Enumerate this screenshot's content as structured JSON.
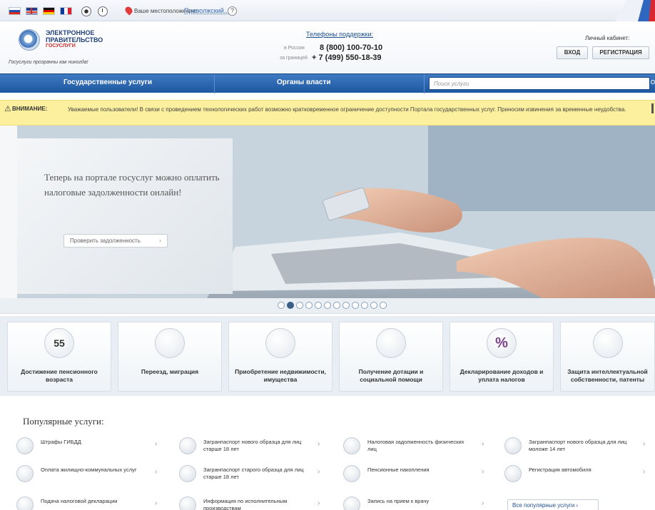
{
  "topbar": {
    "location_label": "Ваше местоположение:",
    "location_value": "Приволжский...",
    "help": "?"
  },
  "header": {
    "logo_line1": "ЭЛЕКТРОННОЕ",
    "logo_line2": "ПРАВИТЕЛЬСТВО",
    "logo_line3": "ГОСУСЛУГИ",
    "slogan": "Госуслуги прозрачны как никогда!",
    "support_title": "Телефоны поддержки:",
    "support_label_russia": "в России",
    "support_phone_russia": "8 (800) 100-70-10",
    "support_label_abroad": "за границей",
    "support_phone_abroad": "+ 7 (499) 550-18-39",
    "cabinet_title": "Личный кабинет:",
    "login": "ВХОД",
    "register": "РЕГИСТРАЦИЯ"
  },
  "nav": {
    "services": "Государственные услуги",
    "authorities": "Органы власти",
    "search_placeholder": "Поиск услуги"
  },
  "alert": {
    "icon": "⚠",
    "title": "ВНИМАНИЕ:",
    "text": "Уважаемые пользователи! В связи с проведением технологических работ возможно кратковременное ограничение доступности Портала государственных услуг. Приносим извинения за временные неудобства."
  },
  "banner": {
    "text": "Теперь на портале госуслуг можно оплатить налоговые задолженности онлайн!",
    "button": "Проверить задолженность",
    "arrow": "›",
    "dots_count": 12,
    "active_dot": 2
  },
  "categories": [
    {
      "label": "Достижение пенсионного возраста",
      "icon": "calendar-55-icon",
      "badge": "55"
    },
    {
      "label": "Переезд, миграция",
      "icon": "passport-icon",
      "badge": ""
    },
    {
      "label": "Приобретение недвижимости, имущества",
      "icon": "keys-icon",
      "badge": ""
    },
    {
      "label": "Получение дотации и социальной помощи",
      "icon": "lifebuoy-icon",
      "badge": ""
    },
    {
      "label": "Декларирование доходов и уплата налогов",
      "icon": "percent-icon",
      "badge": "%"
    },
    {
      "label": "Защита интеллектуальной собственности, патенты",
      "icon": "certificate-icon",
      "badge": ""
    }
  ],
  "popular": {
    "title": "Популярные услуги:",
    "items": [
      "Штрафы ГИБДД",
      "Загранпаспорт нового образца для лиц старше 18 лет",
      "Налоговая задолженность физических лиц",
      "Загранпаспорт нового образца для лиц моложе 14 лет",
      "Оплата жилищно-коммунальных услуг",
      "Загранпаспорт старого образца для лиц старше 18 лет",
      "Пенсионные накопления",
      "Регистрация автомобиля",
      "Подача налоговой декларации",
      "Информация по исполнительным производствам",
      "Запись на прием к врачу"
    ],
    "all_link": "Все популярные услуги  ›",
    "arrow": "›"
  }
}
